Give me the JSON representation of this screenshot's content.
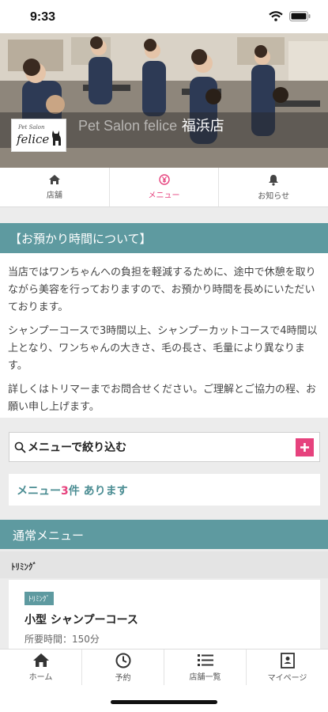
{
  "status_bar": {
    "time": "9:33"
  },
  "hero": {
    "logo_small": "Pet Salon",
    "logo_main": "felice",
    "shop_name_en": "Pet Salon felice",
    "shop_name_jp": "福浜店"
  },
  "tabs": [
    {
      "label": "店舗",
      "icon": "home-icon",
      "active": false
    },
    {
      "label": "メニュー",
      "icon": "yen-icon",
      "active": true
    },
    {
      "label": "お知らせ",
      "icon": "bell-icon",
      "active": false
    }
  ],
  "notice": {
    "title": "【お預かり時間について】",
    "paragraphs": [
      "当店ではワンちゃんへの負担を軽減するために、途中で休憩を取りながら美容を行っておりますので、お預かり時間を長めにいただいております。",
      "シャンプーコースで3時間以上、シャンプーカットコースで4時間以上となり、ワンちゃんの大きさ、毛の長さ、毛量により異なります。",
      "詳しくはトリマーまでお問合せください。ご理解とご協力の程、お願い申し上げます。"
    ]
  },
  "search": {
    "label": "メニューで絞り込む",
    "icon": "search-icon"
  },
  "count": {
    "prefix": "メニュー",
    "number": "3",
    "suffix": "件 あります"
  },
  "menu_section": {
    "title": "通常メニュー"
  },
  "category": {
    "label": "ﾄﾘﾐﾝｸﾞ"
  },
  "menu_items": [
    {
      "tag": "ﾄﾘﾐﾝｸﾞ",
      "title": "小型 シャンプーコース",
      "time": "所要時間：150分"
    }
  ],
  "bottom_nav": [
    {
      "label": "ホーム",
      "icon": "home-icon"
    },
    {
      "label": "予約",
      "icon": "clock-icon"
    },
    {
      "label": "店舗一覧",
      "icon": "list-icon"
    },
    {
      "label": "マイページ",
      "icon": "id-card-icon"
    }
  ],
  "colors": {
    "accent": "#e6427d",
    "teal": "#5e9aa0"
  }
}
